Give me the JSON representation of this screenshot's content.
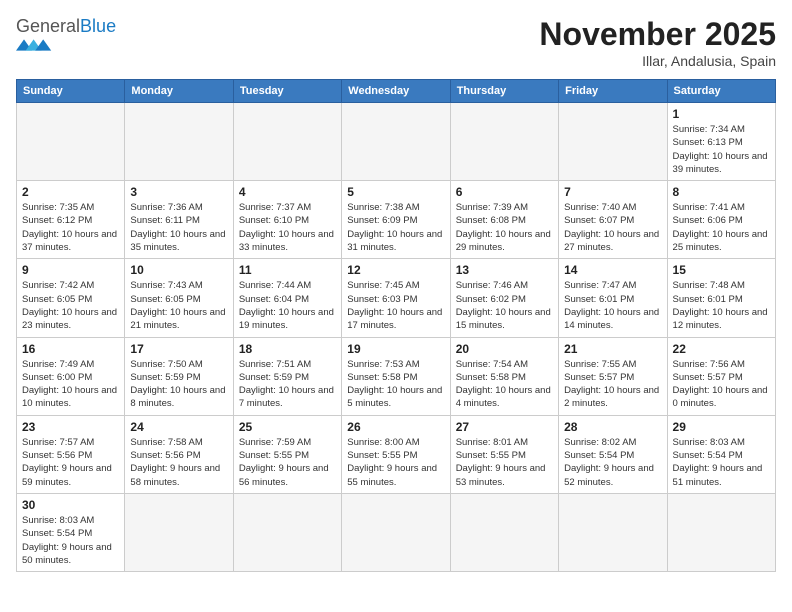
{
  "header": {
    "logo_general": "General",
    "logo_blue": "Blue",
    "month_year": "November 2025",
    "location": "Illar, Andalusia, Spain"
  },
  "weekdays": [
    "Sunday",
    "Monday",
    "Tuesday",
    "Wednesday",
    "Thursday",
    "Friday",
    "Saturday"
  ],
  "weeks": [
    [
      {
        "day": "",
        "info": ""
      },
      {
        "day": "",
        "info": ""
      },
      {
        "day": "",
        "info": ""
      },
      {
        "day": "",
        "info": ""
      },
      {
        "day": "",
        "info": ""
      },
      {
        "day": "",
        "info": ""
      },
      {
        "day": "1",
        "info": "Sunrise: 7:34 AM\nSunset: 6:13 PM\nDaylight: 10 hours and 39 minutes."
      }
    ],
    [
      {
        "day": "2",
        "info": "Sunrise: 7:35 AM\nSunset: 6:12 PM\nDaylight: 10 hours and 37 minutes."
      },
      {
        "day": "3",
        "info": "Sunrise: 7:36 AM\nSunset: 6:11 PM\nDaylight: 10 hours and 35 minutes."
      },
      {
        "day": "4",
        "info": "Sunrise: 7:37 AM\nSunset: 6:10 PM\nDaylight: 10 hours and 33 minutes."
      },
      {
        "day": "5",
        "info": "Sunrise: 7:38 AM\nSunset: 6:09 PM\nDaylight: 10 hours and 31 minutes."
      },
      {
        "day": "6",
        "info": "Sunrise: 7:39 AM\nSunset: 6:08 PM\nDaylight: 10 hours and 29 minutes."
      },
      {
        "day": "7",
        "info": "Sunrise: 7:40 AM\nSunset: 6:07 PM\nDaylight: 10 hours and 27 minutes."
      },
      {
        "day": "8",
        "info": "Sunrise: 7:41 AM\nSunset: 6:06 PM\nDaylight: 10 hours and 25 minutes."
      }
    ],
    [
      {
        "day": "9",
        "info": "Sunrise: 7:42 AM\nSunset: 6:05 PM\nDaylight: 10 hours and 23 minutes."
      },
      {
        "day": "10",
        "info": "Sunrise: 7:43 AM\nSunset: 6:05 PM\nDaylight: 10 hours and 21 minutes."
      },
      {
        "day": "11",
        "info": "Sunrise: 7:44 AM\nSunset: 6:04 PM\nDaylight: 10 hours and 19 minutes."
      },
      {
        "day": "12",
        "info": "Sunrise: 7:45 AM\nSunset: 6:03 PM\nDaylight: 10 hours and 17 minutes."
      },
      {
        "day": "13",
        "info": "Sunrise: 7:46 AM\nSunset: 6:02 PM\nDaylight: 10 hours and 15 minutes."
      },
      {
        "day": "14",
        "info": "Sunrise: 7:47 AM\nSunset: 6:01 PM\nDaylight: 10 hours and 14 minutes."
      },
      {
        "day": "15",
        "info": "Sunrise: 7:48 AM\nSunset: 6:01 PM\nDaylight: 10 hours and 12 minutes."
      }
    ],
    [
      {
        "day": "16",
        "info": "Sunrise: 7:49 AM\nSunset: 6:00 PM\nDaylight: 10 hours and 10 minutes."
      },
      {
        "day": "17",
        "info": "Sunrise: 7:50 AM\nSunset: 5:59 PM\nDaylight: 10 hours and 8 minutes."
      },
      {
        "day": "18",
        "info": "Sunrise: 7:51 AM\nSunset: 5:59 PM\nDaylight: 10 hours and 7 minutes."
      },
      {
        "day": "19",
        "info": "Sunrise: 7:53 AM\nSunset: 5:58 PM\nDaylight: 10 hours and 5 minutes."
      },
      {
        "day": "20",
        "info": "Sunrise: 7:54 AM\nSunset: 5:58 PM\nDaylight: 10 hours and 4 minutes."
      },
      {
        "day": "21",
        "info": "Sunrise: 7:55 AM\nSunset: 5:57 PM\nDaylight: 10 hours and 2 minutes."
      },
      {
        "day": "22",
        "info": "Sunrise: 7:56 AM\nSunset: 5:57 PM\nDaylight: 10 hours and 0 minutes."
      }
    ],
    [
      {
        "day": "23",
        "info": "Sunrise: 7:57 AM\nSunset: 5:56 PM\nDaylight: 9 hours and 59 minutes."
      },
      {
        "day": "24",
        "info": "Sunrise: 7:58 AM\nSunset: 5:56 PM\nDaylight: 9 hours and 58 minutes."
      },
      {
        "day": "25",
        "info": "Sunrise: 7:59 AM\nSunset: 5:55 PM\nDaylight: 9 hours and 56 minutes."
      },
      {
        "day": "26",
        "info": "Sunrise: 8:00 AM\nSunset: 5:55 PM\nDaylight: 9 hours and 55 minutes."
      },
      {
        "day": "27",
        "info": "Sunrise: 8:01 AM\nSunset: 5:55 PM\nDaylight: 9 hours and 53 minutes."
      },
      {
        "day": "28",
        "info": "Sunrise: 8:02 AM\nSunset: 5:54 PM\nDaylight: 9 hours and 52 minutes."
      },
      {
        "day": "29",
        "info": "Sunrise: 8:03 AM\nSunset: 5:54 PM\nDaylight: 9 hours and 51 minutes."
      }
    ],
    [
      {
        "day": "30",
        "info": "Sunrise: 8:03 AM\nSunset: 5:54 PM\nDaylight: 9 hours and 50 minutes."
      },
      {
        "day": "",
        "info": ""
      },
      {
        "day": "",
        "info": ""
      },
      {
        "day": "",
        "info": ""
      },
      {
        "day": "",
        "info": ""
      },
      {
        "day": "",
        "info": ""
      },
      {
        "day": "",
        "info": ""
      }
    ]
  ]
}
